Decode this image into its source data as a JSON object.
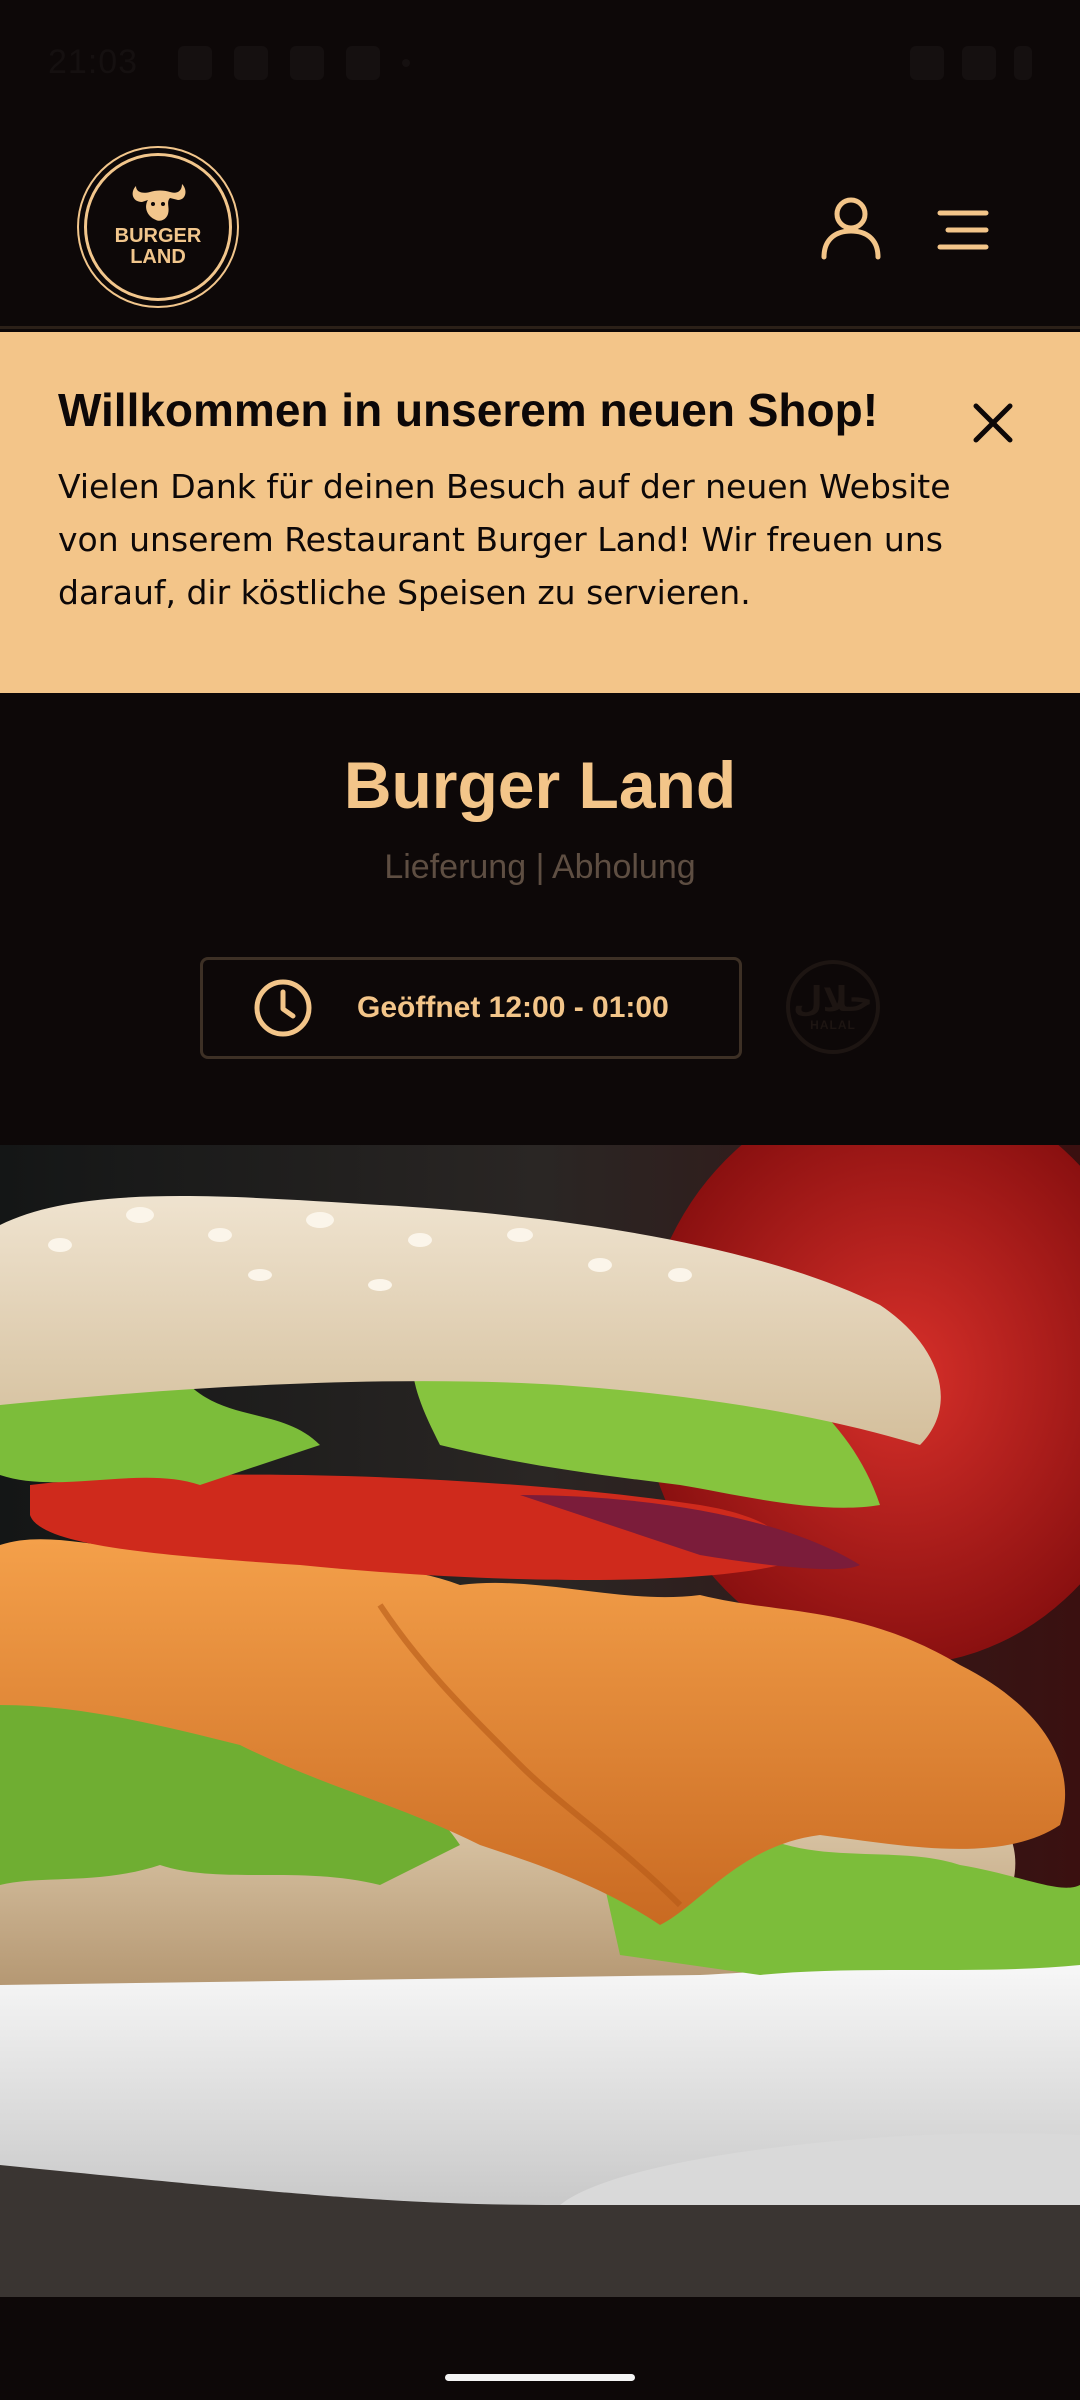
{
  "status_bar": {
    "time": "21:03"
  },
  "header": {
    "logo_line1": "BURGER",
    "logo_line2": "LAND"
  },
  "banner": {
    "title": "Willkommen in unserem neuen Shop!",
    "text": "Vielen Dank für deinen Besuch auf der neuen Website von unserem Restaurant Burger Land! Wir freuen uns darauf, dir köstliche Speisen zu servieren."
  },
  "restaurant": {
    "name": "Burger Land",
    "service_modes": "Lieferung | Abholung",
    "opening_hours": "Geöffnet 12:00 - 01:00",
    "halal_arabic": "حلال",
    "halal_label": "HALAL"
  },
  "colors": {
    "background": "#0d0808",
    "accent": "#f3c589",
    "muted": "#5e4e42"
  },
  "icons": {
    "user": "user-icon",
    "menu": "hamburger-menu-icon",
    "close": "close-icon",
    "clock": "clock-icon"
  }
}
